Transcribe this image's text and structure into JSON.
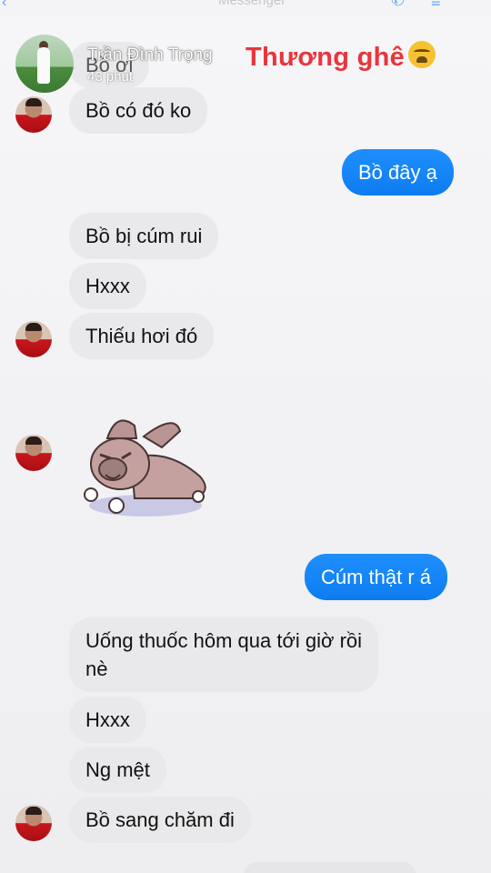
{
  "header": {
    "app_title": "Messenger"
  },
  "story": {
    "username": "Trần Đình Trọng",
    "time": "43 phút",
    "caption": "Thương ghê"
  },
  "messages": [
    {
      "side": "in",
      "text": "Bồ ơi"
    },
    {
      "side": "in",
      "text": "Bồ có đó ko"
    },
    {
      "side": "out",
      "text": "Bồ đây ạ"
    },
    {
      "side": "in",
      "text": "Bồ bị cúm rui"
    },
    {
      "side": "in",
      "text": "Hxxx"
    },
    {
      "side": "in",
      "text": "Thiếu hơi đó"
    },
    {
      "side": "in",
      "sticker": "crying-bulldog-sticker"
    },
    {
      "side": "out",
      "text": "Cúm thật r á"
    },
    {
      "side": "in",
      "text": "Uống thuốc hôm qua tới giờ rồi nè"
    },
    {
      "side": "in",
      "text": "Hxxx"
    },
    {
      "side": "in",
      "text": "Ng mệt"
    },
    {
      "side": "in",
      "text": "Bồ sang chăm đi"
    }
  ],
  "icons": {
    "story_emoji": "crying-face-emoji",
    "sticker": "crying-bulldog-sticker"
  },
  "colors": {
    "outgoing_bubble": "#0c7cf0",
    "incoming_bubble": "#e9e9eb",
    "caption": "#e8353d"
  }
}
